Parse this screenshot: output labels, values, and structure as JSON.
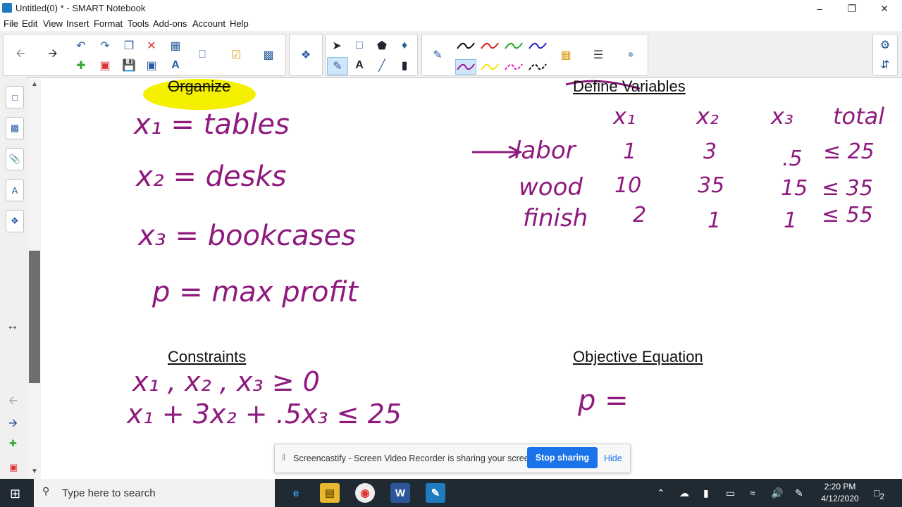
{
  "window": {
    "title": "Untitled(0) * - SMART Notebook"
  },
  "menu": [
    "File",
    "Edit",
    "View",
    "Insert",
    "Format",
    "Tools",
    "Add-ons",
    "Account",
    "Help"
  ],
  "headings": {
    "constraints": "Constraints",
    "objective": "Objective Equation",
    "organize": "Organize",
    "define": "Define Variables"
  },
  "variables": {
    "x1": "x₁ = tables",
    "x2": "x₂ = desks",
    "x3": "x₃ = bookcases",
    "p": "p = max profit"
  },
  "table": {
    "columns": [
      "x₁",
      "x₂",
      "x₃",
      "total"
    ],
    "rows": [
      {
        "label": "labor",
        "values": [
          "1",
          "3",
          ".5",
          "≤ 25"
        ]
      },
      {
        "label": "wood",
        "values": [
          "10",
          "35",
          "15",
          "≤ 35"
        ]
      },
      {
        "label": "finish",
        "values": [
          "2",
          "1",
          "1",
          "≤ 55"
        ]
      }
    ]
  },
  "constraints": {
    "line1": "x₁ , x₂ , x₃ ≥ 0",
    "line2": "x₁ + 3x₂ + .5x₃ ≤ 25"
  },
  "objective": {
    "line1": "p ="
  },
  "popup": {
    "message": "Screencastify - Screen Video Recorder is sharing your screen.",
    "stop_label": "Stop sharing",
    "hide_label": "Hide"
  },
  "taskbar": {
    "search_placeholder": "Type here to search",
    "time": "2:20 PM",
    "date": "4/12/2020",
    "notifications": "2"
  },
  "colors": {
    "ink": "#8e1a7e",
    "highlight": "#f4f000",
    "accent": "#1a73e8"
  }
}
